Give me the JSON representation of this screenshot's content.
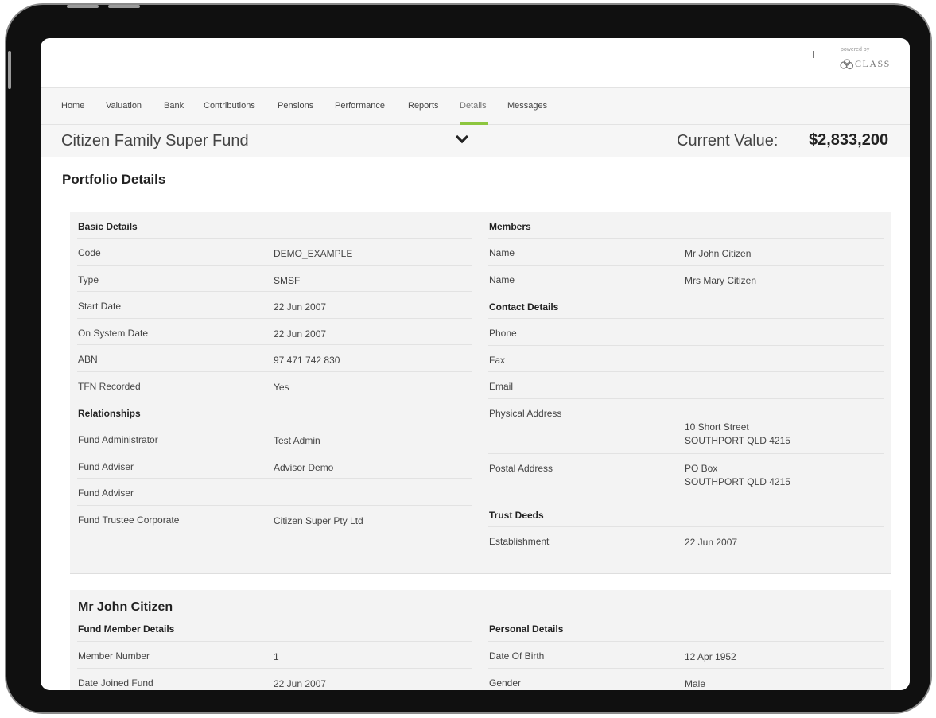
{
  "brand": {
    "powered_by": "powered by",
    "logo_text": "CLASS",
    "accent": "#8dc63f"
  },
  "nav": {
    "items": [
      "Home",
      "Valuation",
      "Bank",
      "Contributions",
      "Pensions",
      "Performance",
      "Reports",
      "Details",
      "Messages"
    ],
    "active": "Details"
  },
  "fund": {
    "name": "Citizen Family Super Fund",
    "current_value_label": "Current Value:",
    "current_value": "$2,833,200"
  },
  "page": {
    "title": "Portfolio Details"
  },
  "basic_details": {
    "heading": "Basic Details",
    "rows": [
      {
        "label": "Code",
        "value": "DEMO_EXAMPLE"
      },
      {
        "label": "Type",
        "value": "SMSF"
      },
      {
        "label": "Start Date",
        "value": "22 Jun 2007"
      },
      {
        "label": "On System Date",
        "value": "22 Jun 2007"
      },
      {
        "label": "ABN",
        "value": "97 471 742 830"
      },
      {
        "label": "TFN Recorded",
        "value": "Yes"
      }
    ]
  },
  "relationships": {
    "heading": "Relationships",
    "rows": [
      {
        "label": "Fund Administrator",
        "value": "Test Admin"
      },
      {
        "label": "Fund Adviser",
        "value": "Advisor Demo"
      },
      {
        "label": "Fund Adviser",
        "value": ""
      },
      {
        "label": "Fund Trustee Corporate",
        "value": "Citizen Super Pty Ltd"
      }
    ]
  },
  "members": {
    "heading": "Members",
    "rows": [
      {
        "label": "Name",
        "value": "Mr John Citizen"
      },
      {
        "label": "Name",
        "value": "Mrs Mary Citizen"
      }
    ]
  },
  "contact_details": {
    "heading": "Contact Details",
    "phone_label": "Phone",
    "fax_label": "Fax",
    "email_label": "Email",
    "physical_label": "Physical Address",
    "physical_line1": "10 Short Street",
    "physical_line2": "SOUTHPORT QLD 4215",
    "postal_label": "Postal Address",
    "postal_line1": "PO Box",
    "postal_line2": "SOUTHPORT QLD 4215"
  },
  "trust_deeds": {
    "heading": "Trust Deeds",
    "rows": [
      {
        "label": "Establishment",
        "value": "22 Jun 2007"
      }
    ]
  },
  "member_section": {
    "name": "Mr John Citizen",
    "fund_member_heading": "Fund Member Details",
    "fund_member_rows": [
      {
        "label": "Member Number",
        "value": "1"
      },
      {
        "label": "Date Joined Fund",
        "value": "22 Jun 2007"
      }
    ],
    "personal_heading": "Personal Details",
    "personal_rows": [
      {
        "label": "Date Of Birth",
        "value": "12 Apr 1952"
      },
      {
        "label": "Gender",
        "value": "Male"
      }
    ]
  }
}
